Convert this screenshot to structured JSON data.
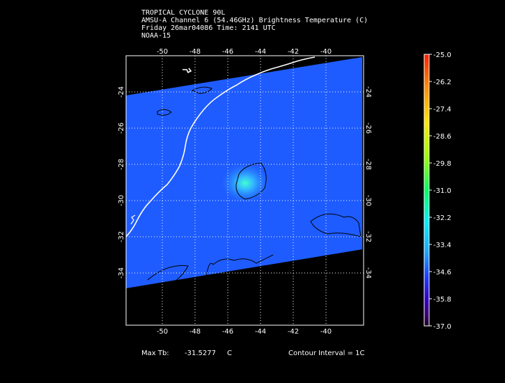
{
  "header": {
    "line1": "TROPICAL CYCLONE 90L",
    "line2": "AMSU-A Channel 6 (54.46GHz) Brightness Temperature (C)",
    "line3": "Friday 26mar04086 Time: 2141 UTC",
    "line4": "NOAA-15"
  },
  "axes": {
    "lon_ticks": [
      "-50",
      "-48",
      "-46",
      "-44",
      "-42",
      "-40"
    ],
    "lat_ticks": [
      "-24",
      "-26",
      "-28",
      "-30",
      "-32",
      "-34"
    ]
  },
  "colorbar": {
    "labels": [
      "-25.0",
      "-26.2",
      "-27.4",
      "-28.6",
      "-29.8",
      "-31.0",
      "-32.2",
      "-33.4",
      "-34.6",
      "-35.8",
      "-37.0"
    ]
  },
  "footer": {
    "max_tb_label": "Max Tb:",
    "max_tb_value": "-31.5277",
    "max_tb_unit": "C",
    "contour_text": "Contour Interval = 1C"
  },
  "colors": {
    "swath_fill": "#1f5cff",
    "background": "#000000",
    "coastline": "#ffffff",
    "contour": "#000000"
  }
}
